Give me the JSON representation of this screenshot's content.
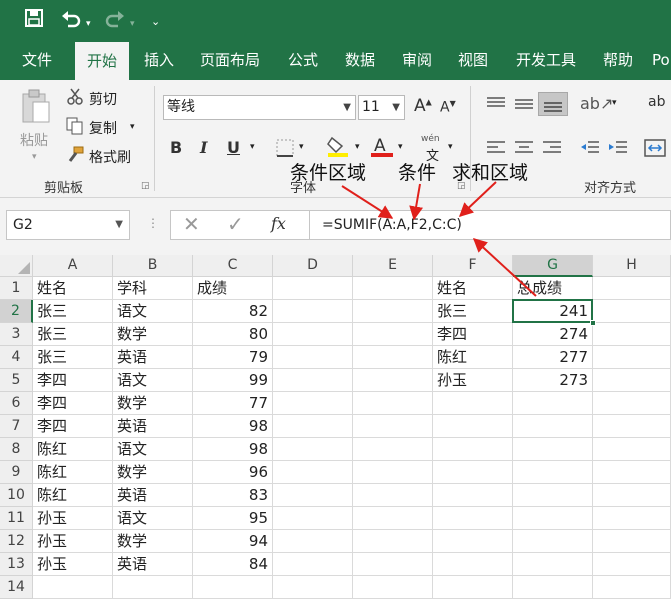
{
  "tabs": [
    "文件",
    "开始",
    "插入",
    "页面布局",
    "公式",
    "数据",
    "审阅",
    "视图",
    "开发工具",
    "帮助",
    "Po"
  ],
  "active_tab": "开始",
  "ribbon": {
    "clipboard": {
      "paste": "粘贴",
      "cut": "剪切",
      "copy": "复制",
      "format_painter": "格式刷",
      "group_label": "剪贴板"
    },
    "font": {
      "name": "等线",
      "size": "11",
      "group_label": "字体",
      "bold": "B",
      "italic": "I",
      "underline": "U",
      "phonetic": "wén"
    },
    "alignment": {
      "group_label": "对齐方式"
    }
  },
  "annotations": [
    "条件区域",
    "条件",
    "求和区域"
  ],
  "formula_bar": {
    "name_box": "G2",
    "fx": "fx",
    "formula": "=SUMIF(A:A,F2,C:C)"
  },
  "columns": [
    "A",
    "B",
    "C",
    "D",
    "E",
    "F",
    "G",
    "H"
  ],
  "rows": [
    "1",
    "2",
    "3",
    "4",
    "5",
    "6",
    "7",
    "8",
    "9",
    "10",
    "11",
    "12",
    "13",
    "14"
  ],
  "sheet": {
    "headers": {
      "A": "姓名",
      "B": "学科",
      "C": "成绩",
      "F": "姓名",
      "G": "总成绩"
    },
    "data": [
      {
        "A": "张三",
        "B": "语文",
        "C": "82",
        "F": "张三",
        "G": "241"
      },
      {
        "A": "张三",
        "B": "数学",
        "C": "80",
        "F": "李四",
        "G": "274"
      },
      {
        "A": "张三",
        "B": "英语",
        "C": "79",
        "F": "陈红",
        "G": "277"
      },
      {
        "A": "李四",
        "B": "语文",
        "C": "99",
        "F": "孙玉",
        "G": "273"
      },
      {
        "A": "李四",
        "B": "数学",
        "C": "77"
      },
      {
        "A": "李四",
        "B": "英语",
        "C": "98"
      },
      {
        "A": "陈红",
        "B": "语文",
        "C": "98"
      },
      {
        "A": "陈红",
        "B": "数学",
        "C": "96"
      },
      {
        "A": "陈红",
        "B": "英语",
        "C": "83"
      },
      {
        "A": "孙玉",
        "B": "语文",
        "C": "95"
      },
      {
        "A": "孙玉",
        "B": "数学",
        "C": "94"
      },
      {
        "A": "孙玉",
        "B": "英语",
        "C": "84"
      }
    ]
  },
  "selected_cell": "G2",
  "colors": {
    "excel_green": "#217346",
    "ribbon_bg": "#f3f3f3",
    "arrow_red": "#e0201b"
  }
}
